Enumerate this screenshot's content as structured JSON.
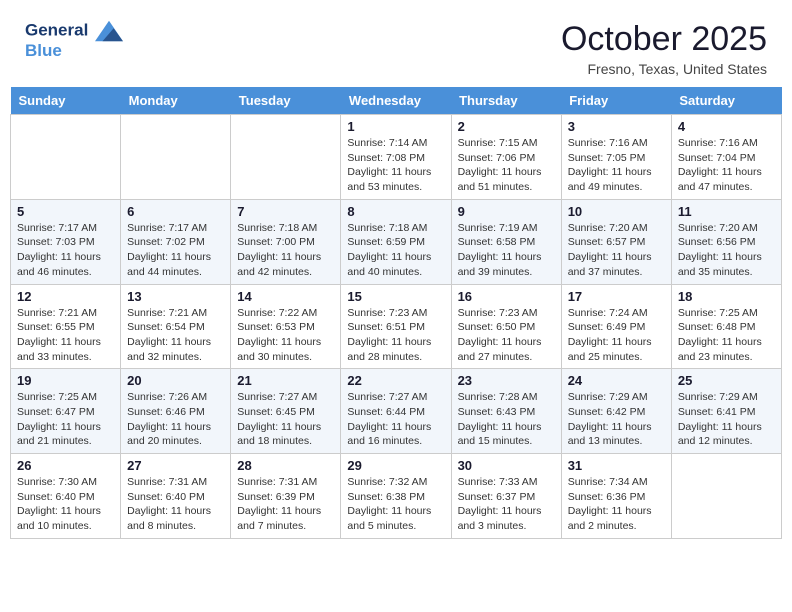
{
  "header": {
    "logo_line1": "General",
    "logo_line2": "Blue",
    "month": "October 2025",
    "location": "Fresno, Texas, United States"
  },
  "weekdays": [
    "Sunday",
    "Monday",
    "Tuesday",
    "Wednesday",
    "Thursday",
    "Friday",
    "Saturday"
  ],
  "weeks": [
    [
      {
        "day": "",
        "sunrise": "",
        "sunset": "",
        "daylight": ""
      },
      {
        "day": "",
        "sunrise": "",
        "sunset": "",
        "daylight": ""
      },
      {
        "day": "",
        "sunrise": "",
        "sunset": "",
        "daylight": ""
      },
      {
        "day": "1",
        "sunrise": "Sunrise: 7:14 AM",
        "sunset": "Sunset: 7:08 PM",
        "daylight": "Daylight: 11 hours and 53 minutes."
      },
      {
        "day": "2",
        "sunrise": "Sunrise: 7:15 AM",
        "sunset": "Sunset: 7:06 PM",
        "daylight": "Daylight: 11 hours and 51 minutes."
      },
      {
        "day": "3",
        "sunrise": "Sunrise: 7:16 AM",
        "sunset": "Sunset: 7:05 PM",
        "daylight": "Daylight: 11 hours and 49 minutes."
      },
      {
        "day": "4",
        "sunrise": "Sunrise: 7:16 AM",
        "sunset": "Sunset: 7:04 PM",
        "daylight": "Daylight: 11 hours and 47 minutes."
      }
    ],
    [
      {
        "day": "5",
        "sunrise": "Sunrise: 7:17 AM",
        "sunset": "Sunset: 7:03 PM",
        "daylight": "Daylight: 11 hours and 46 minutes."
      },
      {
        "day": "6",
        "sunrise": "Sunrise: 7:17 AM",
        "sunset": "Sunset: 7:02 PM",
        "daylight": "Daylight: 11 hours and 44 minutes."
      },
      {
        "day": "7",
        "sunrise": "Sunrise: 7:18 AM",
        "sunset": "Sunset: 7:00 PM",
        "daylight": "Daylight: 11 hours and 42 minutes."
      },
      {
        "day": "8",
        "sunrise": "Sunrise: 7:18 AM",
        "sunset": "Sunset: 6:59 PM",
        "daylight": "Daylight: 11 hours and 40 minutes."
      },
      {
        "day": "9",
        "sunrise": "Sunrise: 7:19 AM",
        "sunset": "Sunset: 6:58 PM",
        "daylight": "Daylight: 11 hours and 39 minutes."
      },
      {
        "day": "10",
        "sunrise": "Sunrise: 7:20 AM",
        "sunset": "Sunset: 6:57 PM",
        "daylight": "Daylight: 11 hours and 37 minutes."
      },
      {
        "day": "11",
        "sunrise": "Sunrise: 7:20 AM",
        "sunset": "Sunset: 6:56 PM",
        "daylight": "Daylight: 11 hours and 35 minutes."
      }
    ],
    [
      {
        "day": "12",
        "sunrise": "Sunrise: 7:21 AM",
        "sunset": "Sunset: 6:55 PM",
        "daylight": "Daylight: 11 hours and 33 minutes."
      },
      {
        "day": "13",
        "sunrise": "Sunrise: 7:21 AM",
        "sunset": "Sunset: 6:54 PM",
        "daylight": "Daylight: 11 hours and 32 minutes."
      },
      {
        "day": "14",
        "sunrise": "Sunrise: 7:22 AM",
        "sunset": "Sunset: 6:53 PM",
        "daylight": "Daylight: 11 hours and 30 minutes."
      },
      {
        "day": "15",
        "sunrise": "Sunrise: 7:23 AM",
        "sunset": "Sunset: 6:51 PM",
        "daylight": "Daylight: 11 hours and 28 minutes."
      },
      {
        "day": "16",
        "sunrise": "Sunrise: 7:23 AM",
        "sunset": "Sunset: 6:50 PM",
        "daylight": "Daylight: 11 hours and 27 minutes."
      },
      {
        "day": "17",
        "sunrise": "Sunrise: 7:24 AM",
        "sunset": "Sunset: 6:49 PM",
        "daylight": "Daylight: 11 hours and 25 minutes."
      },
      {
        "day": "18",
        "sunrise": "Sunrise: 7:25 AM",
        "sunset": "Sunset: 6:48 PM",
        "daylight": "Daylight: 11 hours and 23 minutes."
      }
    ],
    [
      {
        "day": "19",
        "sunrise": "Sunrise: 7:25 AM",
        "sunset": "Sunset: 6:47 PM",
        "daylight": "Daylight: 11 hours and 21 minutes."
      },
      {
        "day": "20",
        "sunrise": "Sunrise: 7:26 AM",
        "sunset": "Sunset: 6:46 PM",
        "daylight": "Daylight: 11 hours and 20 minutes."
      },
      {
        "day": "21",
        "sunrise": "Sunrise: 7:27 AM",
        "sunset": "Sunset: 6:45 PM",
        "daylight": "Daylight: 11 hours and 18 minutes."
      },
      {
        "day": "22",
        "sunrise": "Sunrise: 7:27 AM",
        "sunset": "Sunset: 6:44 PM",
        "daylight": "Daylight: 11 hours and 16 minutes."
      },
      {
        "day": "23",
        "sunrise": "Sunrise: 7:28 AM",
        "sunset": "Sunset: 6:43 PM",
        "daylight": "Daylight: 11 hours and 15 minutes."
      },
      {
        "day": "24",
        "sunrise": "Sunrise: 7:29 AM",
        "sunset": "Sunset: 6:42 PM",
        "daylight": "Daylight: 11 hours and 13 minutes."
      },
      {
        "day": "25",
        "sunrise": "Sunrise: 7:29 AM",
        "sunset": "Sunset: 6:41 PM",
        "daylight": "Daylight: 11 hours and 12 minutes."
      }
    ],
    [
      {
        "day": "26",
        "sunrise": "Sunrise: 7:30 AM",
        "sunset": "Sunset: 6:40 PM",
        "daylight": "Daylight: 11 hours and 10 minutes."
      },
      {
        "day": "27",
        "sunrise": "Sunrise: 7:31 AM",
        "sunset": "Sunset: 6:40 PM",
        "daylight": "Daylight: 11 hours and 8 minutes."
      },
      {
        "day": "28",
        "sunrise": "Sunrise: 7:31 AM",
        "sunset": "Sunset: 6:39 PM",
        "daylight": "Daylight: 11 hours and 7 minutes."
      },
      {
        "day": "29",
        "sunrise": "Sunrise: 7:32 AM",
        "sunset": "Sunset: 6:38 PM",
        "daylight": "Daylight: 11 hours and 5 minutes."
      },
      {
        "day": "30",
        "sunrise": "Sunrise: 7:33 AM",
        "sunset": "Sunset: 6:37 PM",
        "daylight": "Daylight: 11 hours and 3 minutes."
      },
      {
        "day": "31",
        "sunrise": "Sunrise: 7:34 AM",
        "sunset": "Sunset: 6:36 PM",
        "daylight": "Daylight: 11 hours and 2 minutes."
      },
      {
        "day": "",
        "sunrise": "",
        "sunset": "",
        "daylight": ""
      }
    ]
  ]
}
